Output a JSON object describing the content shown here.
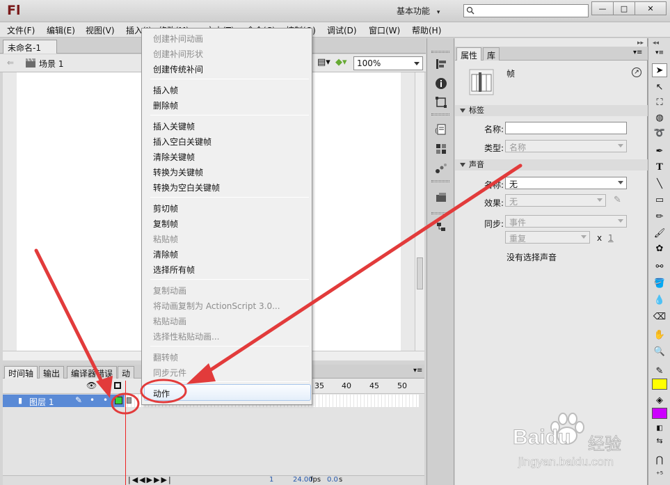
{
  "titlebar": {
    "logo": "Fl",
    "workspace": "基本功能",
    "workspace_arrow": "▾",
    "search_placeholder": ""
  },
  "window_controls": {
    "minimize": "—",
    "maximize": "□",
    "close": "✕"
  },
  "menu": [
    "文件(F)",
    "编辑(E)",
    "视图(V)",
    "插入(I)",
    "修改(M)",
    "文本(T)",
    "命令(C)",
    "控制(O)",
    "调试(D)",
    "窗口(W)",
    "帮助(H)"
  ],
  "document": {
    "tab": "未命名-1",
    "tab_close": "×",
    "scene": "场景 1",
    "zoom": "100%"
  },
  "timeline": {
    "tabs": [
      "时间轴",
      "输出",
      "编译器错误",
      "动"
    ],
    "layer_name": "图层 1",
    "frame_numbers": [
      "35",
      "40",
      "45",
      "50"
    ],
    "fps": "24.00",
    "fps_unit": "fps",
    "time": "0.0",
    "time_unit": "s",
    "current_frame": "1"
  },
  "context_menu": {
    "items": [
      {
        "label": "创建补间动画",
        "enabled": false
      },
      {
        "label": "创建补间形状",
        "enabled": false
      },
      {
        "label": "创建传统补间",
        "enabled": true
      },
      {
        "label": "插入帧",
        "enabled": true
      },
      {
        "label": "删除帧",
        "enabled": true
      },
      {
        "label": "插入关键帧",
        "enabled": true
      },
      {
        "label": "插入空白关键帧",
        "enabled": true
      },
      {
        "label": "清除关键帧",
        "enabled": true
      },
      {
        "label": "转换为关键帧",
        "enabled": true
      },
      {
        "label": "转换为空白关键帧",
        "enabled": true
      },
      {
        "label": "剪切帧",
        "enabled": true
      },
      {
        "label": "复制帧",
        "enabled": true
      },
      {
        "label": "粘贴帧",
        "enabled": false
      },
      {
        "label": "清除帧",
        "enabled": true
      },
      {
        "label": "选择所有帧",
        "enabled": true
      },
      {
        "label": "复制动画",
        "enabled": false
      },
      {
        "label": "将动画复制为 ActionScript 3.0...",
        "enabled": false
      },
      {
        "label": "粘贴动画",
        "enabled": false
      },
      {
        "label": "选择性粘贴动画...",
        "enabled": false
      },
      {
        "label": "翻转帧",
        "enabled": false
      },
      {
        "label": "同步元件",
        "enabled": false
      },
      {
        "label": "动作",
        "enabled": true,
        "highlighted": true
      }
    ]
  },
  "properties": {
    "tabs": [
      "属性",
      "库"
    ],
    "object_type": "帧",
    "section_label": "标签",
    "name_label": "名称:",
    "name_value": "",
    "type_label": "类型:",
    "type_value": "名称",
    "section_sound": "声音",
    "sound_name_label": "名称:",
    "sound_name_value": "无",
    "effect_label": "效果:",
    "effect_value": "无",
    "sync_label": "同步:",
    "sync_value": "事件",
    "repeat_value": "重复",
    "repeat_x": "x",
    "repeat_count": "1",
    "no_sound": "没有选择声音"
  },
  "watermark": {
    "brand": "Baidu",
    "cn": "经验",
    "url": "jingyan.baidu.com"
  },
  "colors": {
    "stroke_swatch": "#ffff00",
    "fill_swatch": "#cc00ff",
    "annotation": "#e23b3b",
    "layer_selected": "#5a8ad6"
  }
}
